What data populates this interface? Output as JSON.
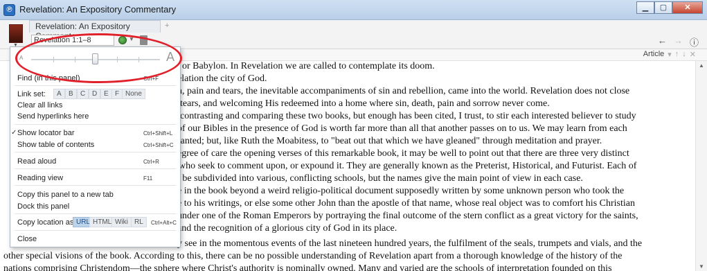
{
  "window": {
    "title": "Revelation: An Expository Commentary"
  },
  "panel": {
    "tab_title": "Revelation: An Expository Commentary",
    "tab_add": "+",
    "reference": "Revelation 1:1–8",
    "article_label": "Article",
    "article_controls": [
      "▾",
      "↑",
      "↓",
      "✕"
    ]
  },
  "nav": {
    "back": "←",
    "forward": "→",
    "info": "ⓘ"
  },
  "menu": {
    "slider": {
      "small_label": "A",
      "large_label": "A",
      "value_fraction": 0.48
    },
    "find": {
      "label": "Find (in this panel)",
      "shortcut": "Ctrl+F"
    },
    "link_set": {
      "label": "Link set:",
      "options": [
        "A",
        "B",
        "C",
        "D",
        "E",
        "F",
        "None"
      ]
    },
    "clear_links": "Clear all links",
    "send_links": "Send hyperlinks here",
    "show_locator": {
      "label": "Show locator bar",
      "shortcut": "Ctrl+Shift+L",
      "checked": true
    },
    "show_toc": {
      "label": "Show table of contents",
      "shortcut": "Ctrl+Shift+C"
    },
    "read_aloud": {
      "label": "Read aloud",
      "shortcut": "Ctrl+R"
    },
    "reading_view": {
      "label": "Reading view",
      "shortcut": "F11"
    },
    "copy_panel": "Copy this panel to a new tab",
    "dock_panel": "Dock this panel",
    "copy_location": {
      "label": "Copy location as:",
      "options": [
        "URL",
        "HTML",
        "Wiki",
        "RL"
      ],
      "selected": "URL",
      "shortcut": "Ctrl+Alt+C"
    },
    "close": "Close"
  },
  "content": {
    "lines": [
      ", or Babylon. In Revelation we are called to contemplate its doom.",
      "elation the city of God.",
      "n, pain and tears, the inevitable accompaniments of sin and rebellion, came into the world. Revelation does not close",
      "tears, and welcoming His redeemed into a home where sin, death, pain and sorrow never come.",
      "contrasting and comparing these two books, but enough has been cited, I trust, to stir each interested believer to study",
      "of our Bibles in the presence of God is worth far more than all that another passes on to us. We may learn from each",
      "ranted; but, like Ruth the Moabitess, to \"beat out that which we have gleaned\" through meditation and prayer.",
      "egree of care the opening verses of this remarkable book, it may be well to point out that there are three very distinct",
      "who seek to comment upon, or expound it. They are generally known as the Preterist, Historical, and Futurist. Each of",
      "t be subdivided into various, conflicting schools, but the names give the main point of view in each case.",
      "e in the book beyond a weird religio-political document supposedly written by some unknown person who took the",
      "e to his writings, or else some other John than the apostle of that name, whose real object was to comfort his Christian",
      "under one of the Roman Emperors by portraying the final outcome of the stern conflict as a great victory for the saints,",
      "and the recognition of a glorious city of God in its place.",
      "y see in the momentous events of the last nineteen hundred years, the fulfilment of the seals, trumpets and vials, and the",
      "other special visions of the book. According to this, there can be no possible understanding of Revelation apart from a thorough knowledge of the history of the",
      "nations comprising Christendom—the sphere where Christ's authority is nominally owned. Many and varied are the schools of interpretation founded on this"
    ]
  },
  "colors": {
    "highlight_ring": "#e0202a",
    "selected_segment": "#bcd3ea"
  }
}
